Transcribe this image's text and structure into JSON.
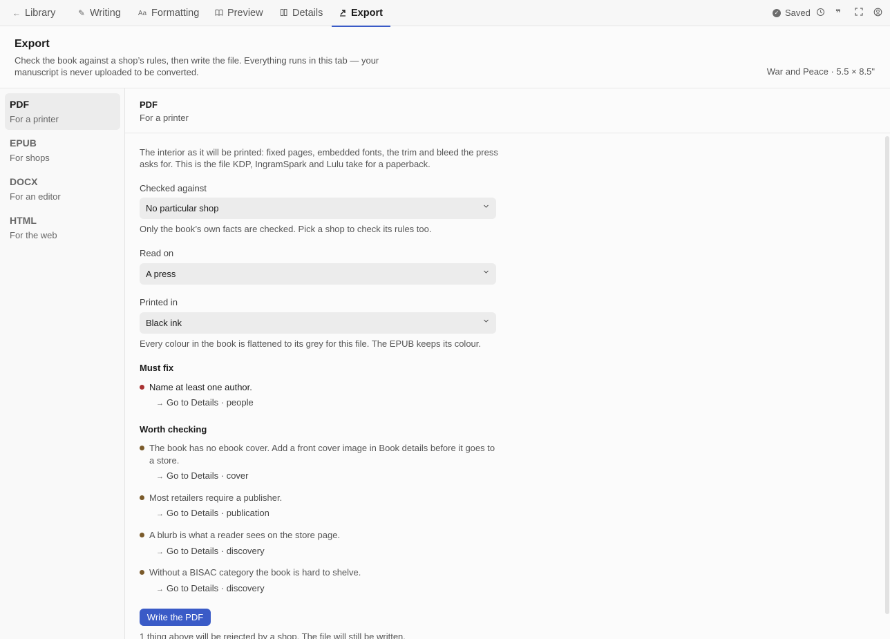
{
  "topbar": {
    "tabs": [
      {
        "label": "Library",
        "icon": "arrow-left-icon"
      },
      {
        "label": "Writing",
        "icon": "pencil-icon"
      },
      {
        "label": "Formatting",
        "icon": "text-format-icon"
      },
      {
        "label": "Preview",
        "icon": "book-icon"
      },
      {
        "label": "Details",
        "icon": "details-icon"
      },
      {
        "label": "Export",
        "icon": "export-arrow-icon"
      }
    ],
    "status": "Saved",
    "tools": [
      "history-icon",
      "quote-icon",
      "fullscreen-icon",
      "account-icon"
    ]
  },
  "header": {
    "title": "Export",
    "description": "Check the book against a shop’s rules, then write the file. Everything runs in this tab — your manuscript is never uploaded to be converted.",
    "book_meta": "War and Peace · 5.5 × 8.5\""
  },
  "formats": [
    {
      "name": "PDF",
      "sub": "For a printer"
    },
    {
      "name": "EPUB",
      "sub": "For shops"
    },
    {
      "name": "DOCX",
      "sub": "For an editor"
    },
    {
      "name": "HTML",
      "sub": "For the web"
    }
  ],
  "main": {
    "title": "PDF",
    "subtitle": "For a printer",
    "intro": "The interior as it will be printed: fixed pages, embedded fonts, the trim and bleed the press asks for. This is the file KDP, IngramSpark and Lulu take for a paperback.",
    "checked_against": {
      "label": "Checked against",
      "value": "No particular shop",
      "help": "Only the book’s own facts are checked. Pick a shop to check its rules too."
    },
    "read_on": {
      "label": "Read on",
      "value": "A press"
    },
    "printed_in": {
      "label": "Printed in",
      "value": "Black ink",
      "help": "Every colour in the book is flattened to its grey for this file. The EPUB keeps its colour."
    },
    "must_fix": {
      "title": "Must fix",
      "items": [
        {
          "text": "Name at least one author.",
          "link": "Go to Details · people"
        }
      ]
    },
    "worth_checking": {
      "title": "Worth checking",
      "items": [
        {
          "text": "The book has no ebook cover. Add a front cover image in Book details before it goes to a store.",
          "link": "Go to Details · cover"
        },
        {
          "text": "Most retailers require a publisher.",
          "link": "Go to Details · publication"
        },
        {
          "text": "A blurb is what a reader sees on the store page.",
          "link": "Go to Details · discovery"
        },
        {
          "text": "Without a BISAC category the book is hard to shelve.",
          "link": "Go to Details · discovery"
        }
      ]
    },
    "write_button": "Write the PDF",
    "footer_note": "1 thing above will be rejected by a shop. The file will still be written."
  },
  "colors": {
    "accent": "#3a5bc7",
    "must_fix_bullet": "#a83232",
    "worth_bullet": "#7a5a2a"
  }
}
